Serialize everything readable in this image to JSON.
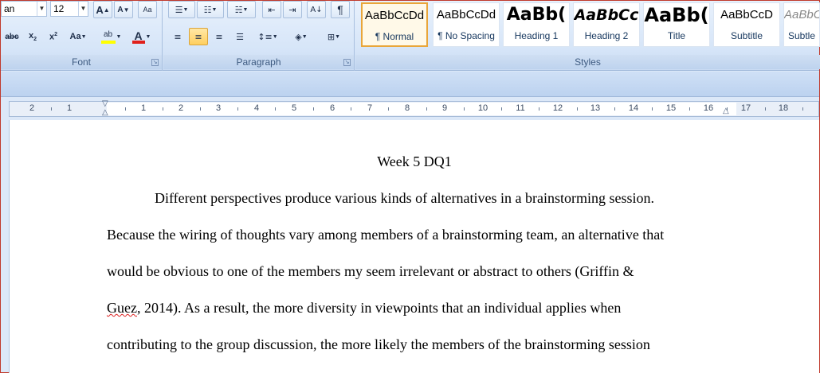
{
  "font_group": {
    "label": "Font",
    "font_name": "an",
    "font_size": "12",
    "grow_font": "A",
    "shrink_font": "A",
    "clear_format": "Aa",
    "strike": "abc",
    "subscript": "x",
    "superscript": "x",
    "change_case": "Aa",
    "highlight": "ab",
    "font_color": "A",
    "colors": {
      "highlight": "#ffff00",
      "font_color": "#e0201b"
    }
  },
  "paragraph_group": {
    "label": "Paragraph",
    "show_marks": "¶"
  },
  "styles_group": {
    "label": "Styles",
    "items": [
      {
        "sample": "AaBbCcDd",
        "name": "¶ Normal"
      },
      {
        "sample": "AaBbCcDd",
        "name": "¶ No Spacing"
      },
      {
        "sample": "AaBb(",
        "name": "Heading 1"
      },
      {
        "sample": "AaBbCc",
        "name": "Heading 2"
      },
      {
        "sample": "AaBb(",
        "name": "Title"
      },
      {
        "sample": "AaBbCcD",
        "name": "Subtitle"
      },
      {
        "sample": "AaBbC",
        "name": "Subtle"
      }
    ]
  },
  "ruler": {
    "numbers": [
      "2",
      "1",
      "1",
      "2",
      "3",
      "4",
      "5",
      "6",
      "7",
      "8",
      "9",
      "10",
      "11",
      "12",
      "13",
      "14",
      "15",
      "16",
      "17",
      "18"
    ]
  },
  "document": {
    "title": "Week 5 DQ1",
    "lines": [
      "Different perspectives produce various kinds of alternatives in a brainstorming session.",
      "Because the wiring of thoughts vary among members of a brainstorming team, an alternative that",
      "would be obvious to one of the members my seem irrelevant or abstract to others (Griffin &",
      "Guez",
      ", 2014). As a result, the more diversity in viewpoints that an individual applies when",
      "contributing to the group discussion, the more likely the members of the brainstorming session"
    ]
  }
}
